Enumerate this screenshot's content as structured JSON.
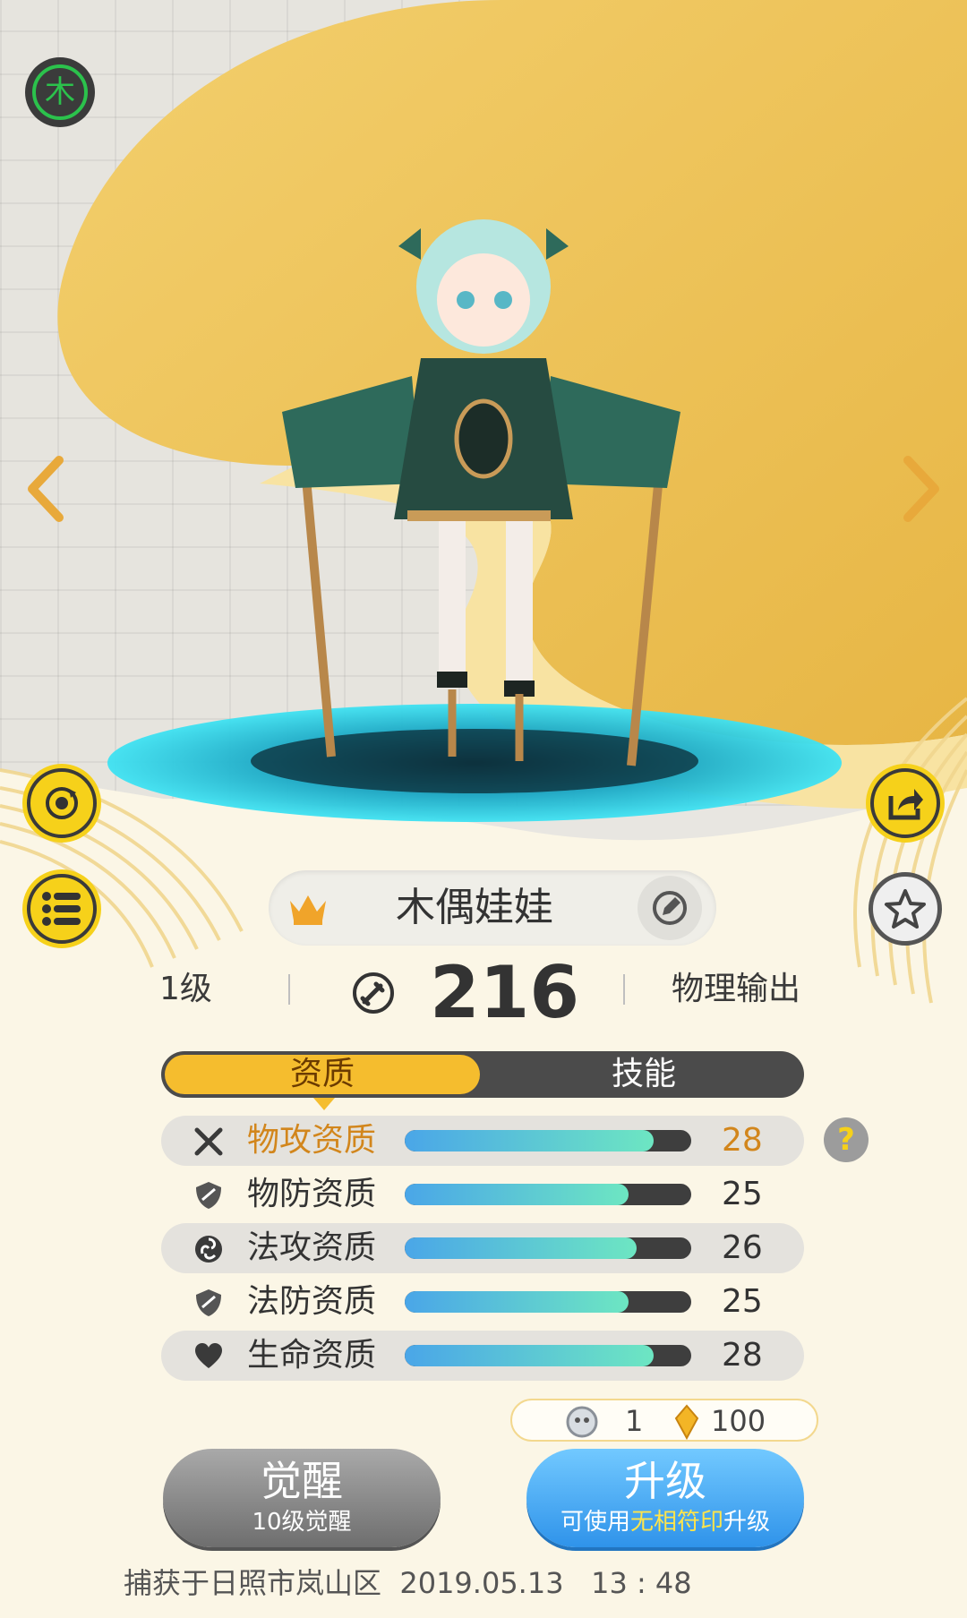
{
  "element_badge": {
    "label": "木",
    "color": "#1e9a3a"
  },
  "character": {
    "name": "木偶娃娃",
    "level": "1级",
    "power": "216",
    "role": "物理输出"
  },
  "tabs": [
    {
      "label": "资质",
      "active": true
    },
    {
      "label": "技能",
      "active": false
    }
  ],
  "stats": [
    {
      "icon": "crossed-swords-icon",
      "label": "物攻资质",
      "value": "28",
      "fill": 0.87,
      "highlighted": true
    },
    {
      "icon": "shield-icon",
      "label": "物防资质",
      "value": "25",
      "fill": 0.78,
      "highlighted": false
    },
    {
      "icon": "swirl-icon",
      "label": "法攻资质",
      "value": "26",
      "fill": 0.81,
      "highlighted": false
    },
    {
      "icon": "shield-icon",
      "label": "法防资质",
      "value": "25",
      "fill": 0.78,
      "highlighted": false
    },
    {
      "icon": "heart-icon",
      "label": "生命资质",
      "value": "28",
      "fill": 0.87,
      "highlighted": false
    }
  ],
  "help_label": "?",
  "cost": {
    "item_count": "1",
    "crystal_count": "100"
  },
  "awaken_button": {
    "title": "觉醒",
    "subtitle": "10级觉醒"
  },
  "upgrade_button": {
    "title": "升级",
    "subtitle_pre": "可使用",
    "subtitle_accent": "无相符印",
    "subtitle_post": "升级"
  },
  "capture_info": "捕获于日照市岚山区  2019.05.13   13 : 48",
  "colors": {
    "accent_yellow": "#f6d11a",
    "tab_active": "#f5bd2e",
    "highlight_text": "#d2861c",
    "bar_start": "#4aa6e8",
    "bar_end": "#6de6c2"
  }
}
